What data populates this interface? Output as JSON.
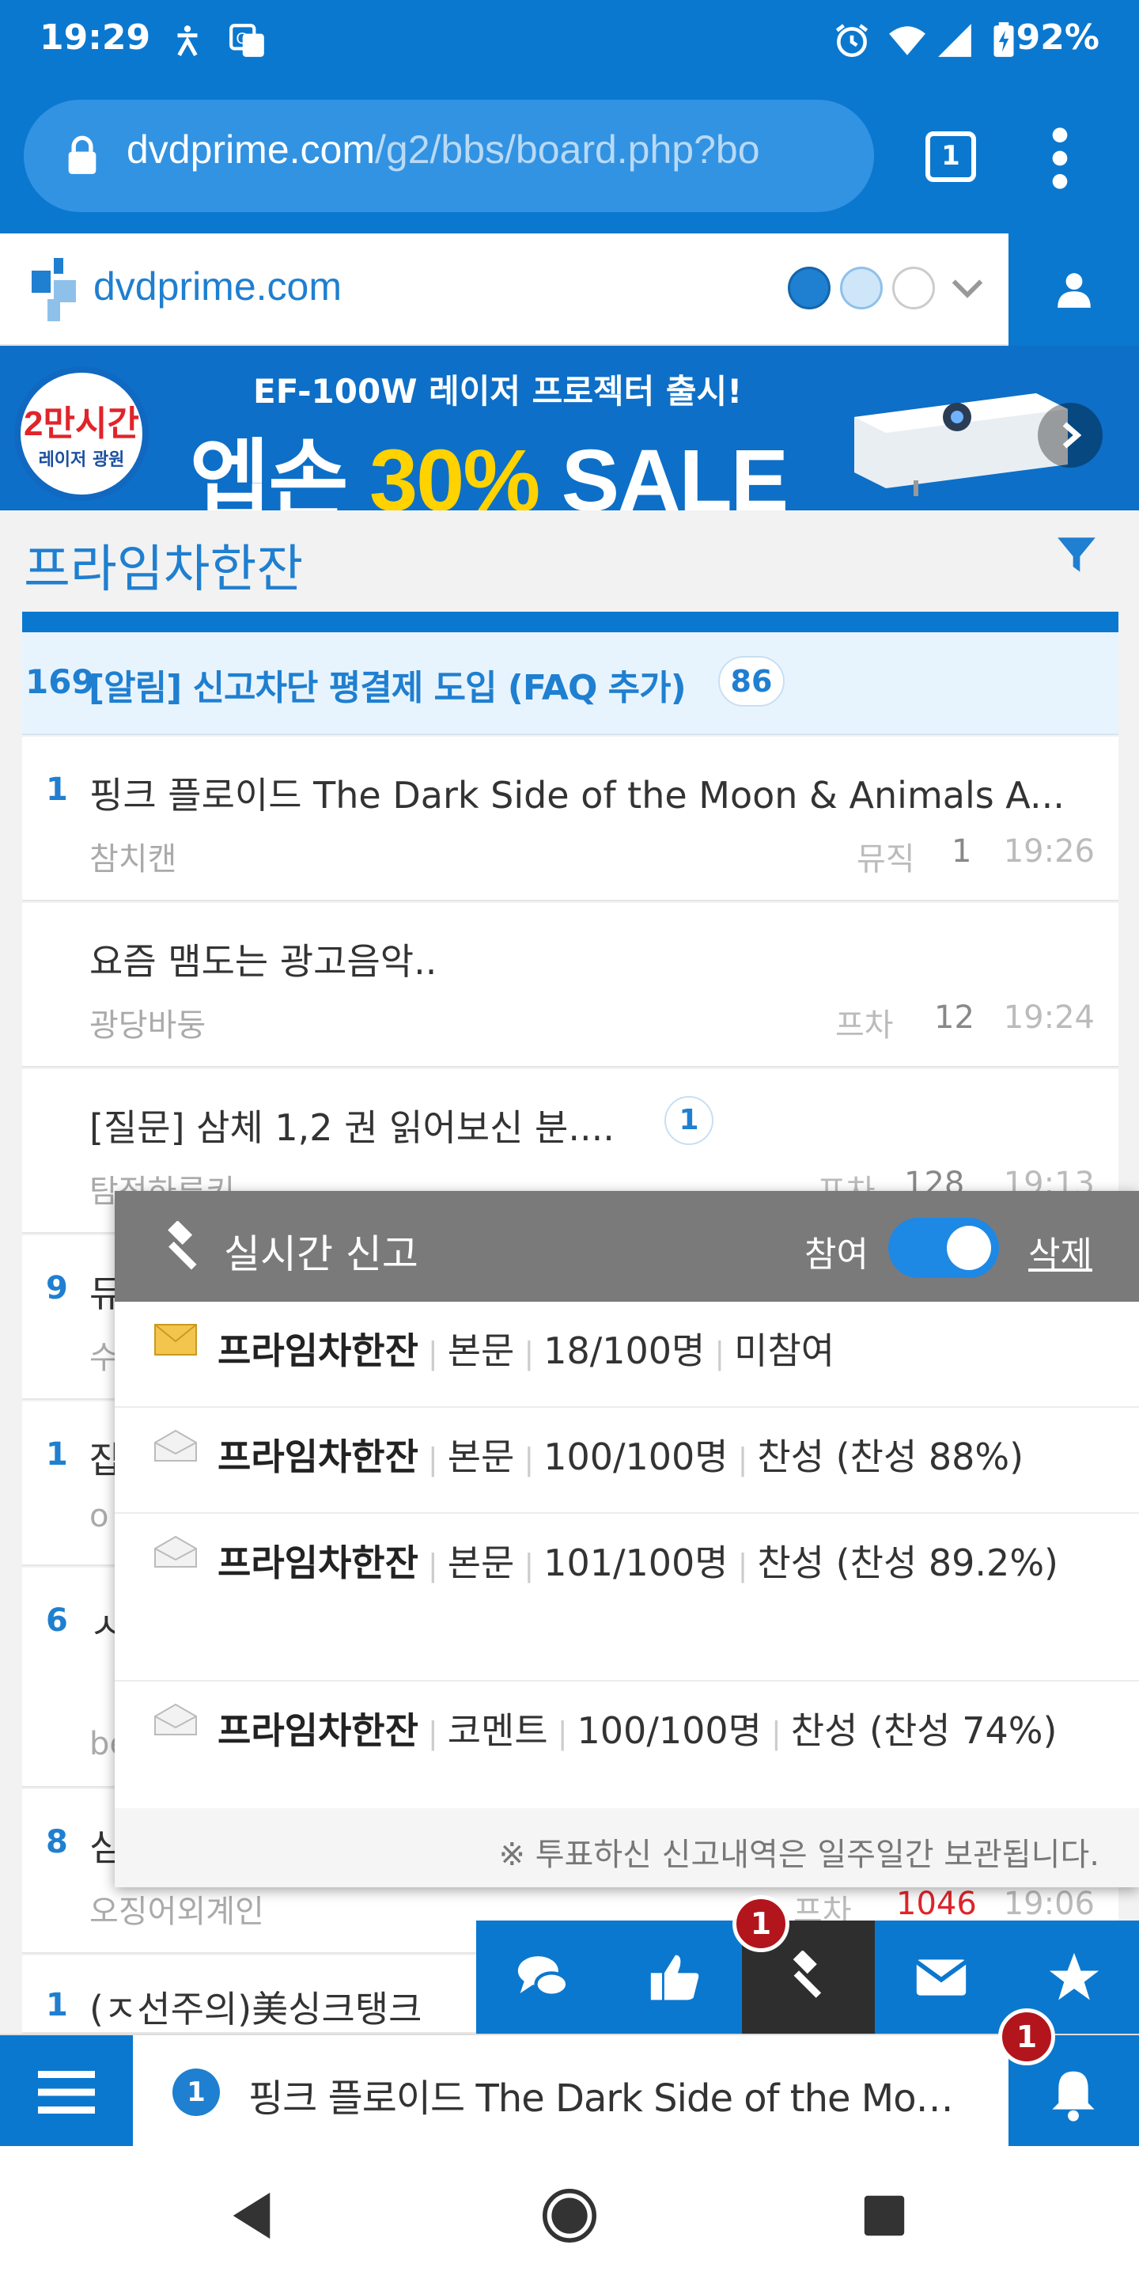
{
  "status_bar": {
    "time": "19:29",
    "battery": "92%",
    "icons": [
      "accessibility-icon",
      "translate-icon",
      "alarm-icon",
      "wifi-icon",
      "signal-icon",
      "battery-charging-icon"
    ]
  },
  "browser": {
    "url_host": "dvdprime.com",
    "url_path": "/g2/bbs/board.php?bo",
    "tab_count": "1"
  },
  "site": {
    "name": "dvdprime.com"
  },
  "banner": {
    "badge_line1": "2만시간",
    "badge_line2": "레이저 광원",
    "headline": "EF-100W 레이저 프로젝터 출시!",
    "sale_brand": "엡손",
    "sale_percent": "30%",
    "sale_word": "SALE"
  },
  "board": {
    "title": "프라임차한잔",
    "notice": {
      "number": "169",
      "title": "[알림] 신고차단 평결제 도입 (FAQ 추가)",
      "comments": "86"
    },
    "posts": [
      {
        "num": "1",
        "title": "핑크 플로이드 The Dark Side of the Moon & Animals A...",
        "author": "참치캔",
        "category": "뮤직",
        "views": "1",
        "time": "19:26",
        "comments": ""
      },
      {
        "num": "",
        "title": "요즘 맴도는 광고음악..",
        "author": "광당바둥",
        "category": "프차",
        "views": "12",
        "time": "19:24",
        "comments": ""
      },
      {
        "num": "",
        "title": "[질문] 삼체 1,2 권 읽어보신 분....",
        "author": "탐정하루키",
        "category": "프차",
        "views": "128",
        "time": "19:13",
        "comments": "1"
      },
      {
        "num": "9",
        "title": "듀",
        "author": "수",
        "category": "",
        "views": "",
        "time": "",
        "comments": ""
      },
      {
        "num": "1",
        "title": "잡",
        "author": "o",
        "category": "",
        "views": "",
        "time": "",
        "comments": ""
      },
      {
        "num": "6",
        "title": "ㅅ",
        "author": "be",
        "category": "",
        "views": "",
        "time": "",
        "comments": ""
      },
      {
        "num": "8",
        "title": "심",
        "author": "오징어외계인",
        "category": "프차",
        "views": "1046",
        "time": "19:06",
        "comments": ""
      },
      {
        "num": "1",
        "title": "(ㅈ선주의)美싱크탱크",
        "author": "",
        "category": "",
        "views": "",
        "time": "",
        "comments": ""
      }
    ]
  },
  "popup": {
    "title": "실시간 신고",
    "participate_label": "참여",
    "participate_on": true,
    "delete_label": "삭제",
    "reports": [
      {
        "board": "프라임차한잔",
        "type": "본문",
        "count": "18/100명",
        "status": "미참여",
        "read": false
      },
      {
        "board": "프라임차한잔",
        "type": "본문",
        "count": "100/100명",
        "status": "찬성 (찬성 88%)",
        "read": true
      },
      {
        "board": "프라임차한잔",
        "type": "본문",
        "count": "101/100명",
        "status": "찬성 (찬성 89.2%)",
        "read": true
      },
      {
        "board": "프라임차한잔",
        "type": "코멘트",
        "count": "100/100명",
        "status": "찬성 (찬성 74%)",
        "read": true
      }
    ],
    "footer_note": "※ 투표하신 신고내역은 일주일간 보관됩니다."
  },
  "action_bar": {
    "buttons": [
      "chat-icon",
      "thumbs-up-icon",
      "gavel-icon",
      "mail-icon",
      "star-icon"
    ],
    "gavel_badge": "1"
  },
  "bottom_bar": {
    "ticker_badge": "1",
    "ticker_text": "핑크 플로이드 The Dark Side of the Moon & ...",
    "bell_badge": "1"
  },
  "colors": {
    "primary": "#0b78cf",
    "accent_text": "#1f7fd0",
    "popup_header": "#7a7a7a",
    "badge_red": "#b3151c",
    "views_hot": "#e0242a"
  }
}
